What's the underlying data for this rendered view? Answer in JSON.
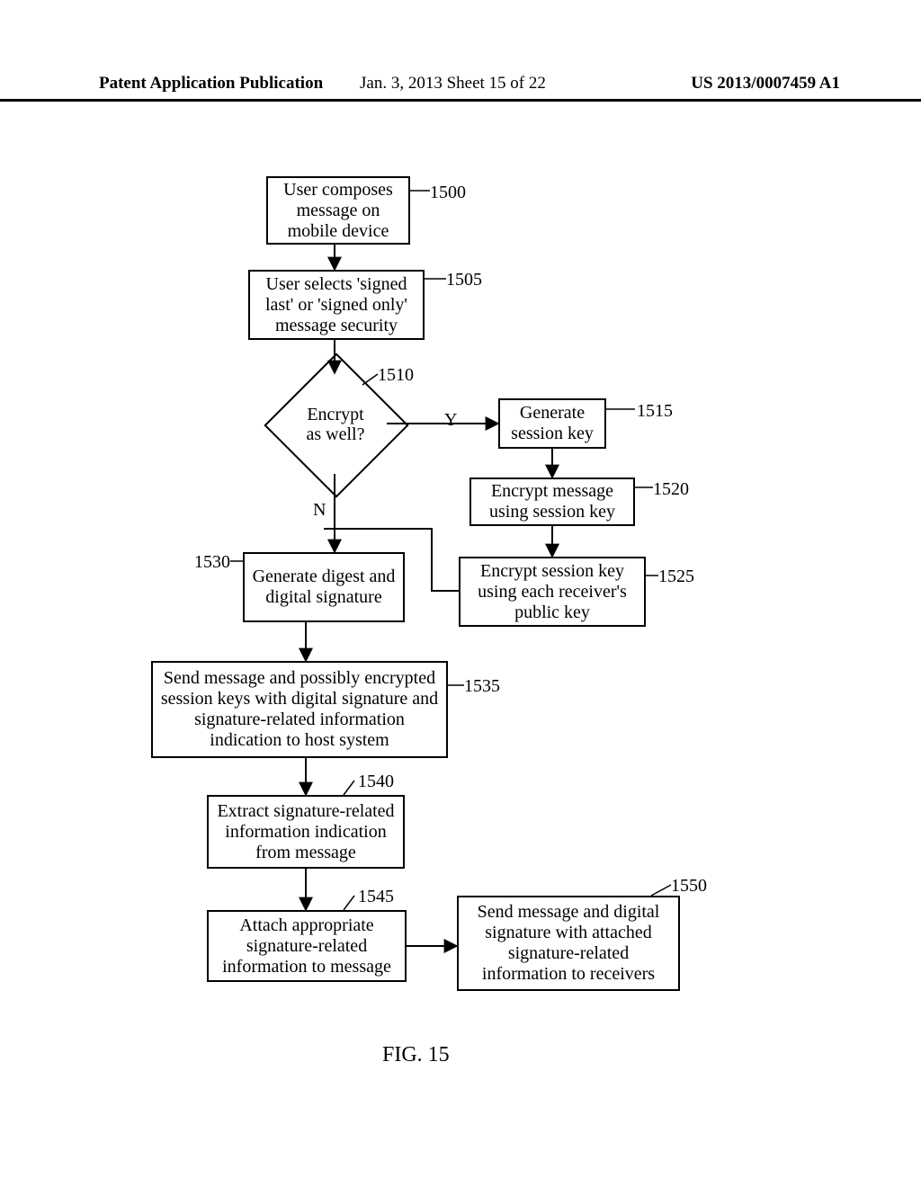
{
  "header": {
    "left": "Patent Application Publication",
    "mid": "Jan. 3, 2013  Sheet 15 of 22",
    "right": "US 2013/0007459 A1"
  },
  "boxes": {
    "b1500": "User composes message on mobile device",
    "b1505": "User selects 'signed last' or 'signed only' message security",
    "b1510": "Encrypt as well?",
    "b1515": "Generate session key",
    "b1520": "Encrypt message using session key",
    "b1525": "Encrypt session key using each receiver's public key",
    "b1530": "Generate digest and digital signature",
    "b1535": "Send message and possibly encrypted session keys with digital signature and signature-related information indication to host system",
    "b1540": "Extract signature-related information indication from message",
    "b1545": "Attach appropriate signature-related information to message",
    "b1550": "Send message and digital signature with attached signature-related information to receivers"
  },
  "refs": {
    "r1500": "1500",
    "r1505": "1505",
    "r1510": "1510",
    "r1515": "1515",
    "r1520": "1520",
    "r1525": "1525",
    "r1530": "1530",
    "r1535": "1535",
    "r1540": "1540",
    "r1545": "1545",
    "r1550": "1550"
  },
  "edge_labels": {
    "Y": "Y",
    "N": "N"
  },
  "fig": "FIG. 15",
  "chart_data": {
    "type": "flowchart",
    "title": "FIG. 15",
    "nodes": [
      {
        "id": "1500",
        "shape": "rect",
        "text": "User composes message on mobile device"
      },
      {
        "id": "1505",
        "shape": "rect",
        "text": "User selects 'signed last' or 'signed only' message security"
      },
      {
        "id": "1510",
        "shape": "decision",
        "text": "Encrypt as well?"
      },
      {
        "id": "1515",
        "shape": "rect",
        "text": "Generate session key"
      },
      {
        "id": "1520",
        "shape": "rect",
        "text": "Encrypt message using session key"
      },
      {
        "id": "1525",
        "shape": "rect",
        "text": "Encrypt session key using each receiver's public key"
      },
      {
        "id": "1530",
        "shape": "rect",
        "text": "Generate digest and digital signature"
      },
      {
        "id": "1535",
        "shape": "rect",
        "text": "Send message and possibly encrypted session keys with digital signature and signature-related information indication to host system"
      },
      {
        "id": "1540",
        "shape": "rect",
        "text": "Extract signature-related information indication from message"
      },
      {
        "id": "1545",
        "shape": "rect",
        "text": "Attach appropriate signature-related information to message"
      },
      {
        "id": "1550",
        "shape": "rect",
        "text": "Send message and digital signature with attached signature-related information to receivers"
      }
    ],
    "edges": [
      {
        "from": "1500",
        "to": "1505"
      },
      {
        "from": "1505",
        "to": "1510"
      },
      {
        "from": "1510",
        "to": "1515",
        "label": "Y"
      },
      {
        "from": "1510",
        "to": "1530",
        "label": "N"
      },
      {
        "from": "1515",
        "to": "1520"
      },
      {
        "from": "1520",
        "to": "1525"
      },
      {
        "from": "1525",
        "to": "1530"
      },
      {
        "from": "1530",
        "to": "1535"
      },
      {
        "from": "1535",
        "to": "1540"
      },
      {
        "from": "1540",
        "to": "1545"
      },
      {
        "from": "1545",
        "to": "1550"
      }
    ]
  }
}
